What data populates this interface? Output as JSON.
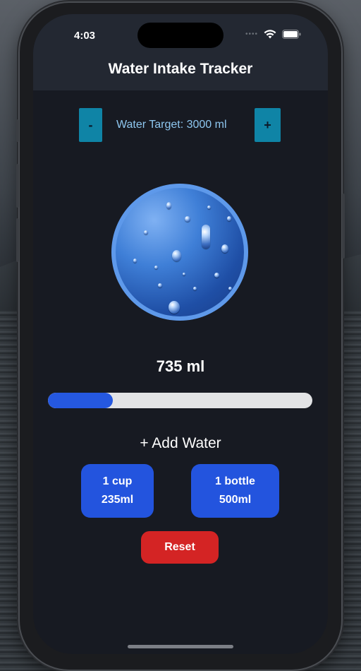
{
  "status_bar": {
    "time": "4:03",
    "wifi_icon": "wifi-icon",
    "battery_icon": "battery-icon"
  },
  "header": {
    "title": "Water Intake Tracker"
  },
  "target": {
    "decrement_label": "-",
    "increment_label": "+",
    "label": "Water Target: 3000 ml"
  },
  "intake": {
    "amount_text": "735 ml",
    "progress_fraction": 0.245
  },
  "add_water": {
    "title": "+ Add Water",
    "options": [
      {
        "line1": "1 cup",
        "line2": "235ml"
      },
      {
        "line1": "1 bottle",
        "line2": "500ml"
      }
    ]
  },
  "reset_label": "Reset",
  "colors": {
    "accent_blue": "#2354de",
    "stepper_teal": "#0f84a6",
    "reset_red": "#d42424",
    "background": "#171a22",
    "header": "#232832"
  }
}
